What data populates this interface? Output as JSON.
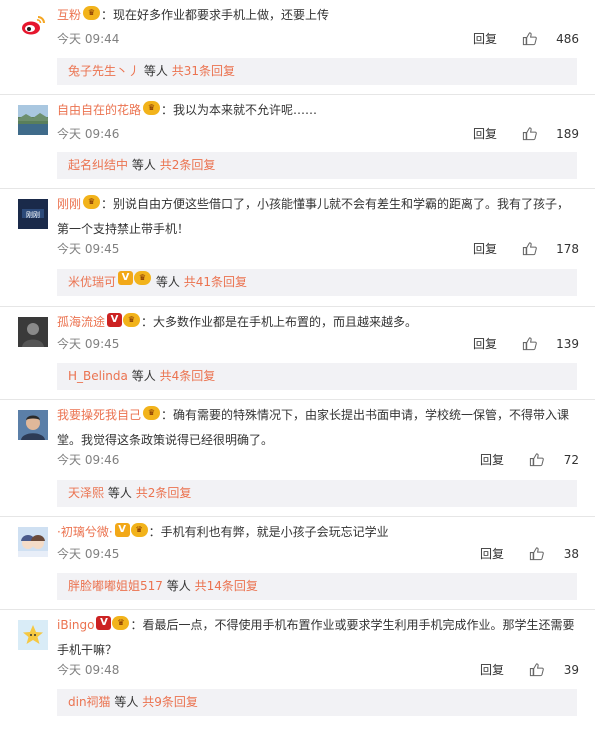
{
  "comments": [
    {
      "username": "互粉",
      "badges": [
        "vip"
      ],
      "text": "现在好多作业都要求手机上做，还要上传",
      "text2": "",
      "time": "今天 09:44",
      "reply_label": "回复",
      "likes": "486",
      "replies_user": "兔子先生丶丿",
      "replies_mid": "等人",
      "replies_total": "共31条回复",
      "avatar": "weibo-logo"
    },
    {
      "username": "自由自在的花路",
      "badges": [
        "vip"
      ],
      "text": "我以为本来就不允许呢……",
      "text2": "",
      "time": "今天 09:46",
      "reply_label": "回复",
      "likes": "189",
      "replies_user": "起名纠结中",
      "replies_mid": "等人",
      "replies_total": "共2条回复",
      "avatar": "landscape"
    },
    {
      "username": "刚刚",
      "badges": [
        "vip"
      ],
      "text": "别说自由方便这些借口了，小孩能懂事儿就不会有差生和学霸的距离了。我有了孩子，",
      "text2": "第一个支持禁止带手机！",
      "time": "今天 09:45",
      "reply_label": "回复",
      "likes": "178",
      "replies_user": "米优瑞可",
      "replies_mid": "等人",
      "replies_total": "共41条回复",
      "avatar": "gangang-logo"
    },
    {
      "username": "孤海流途",
      "badges": [
        "v",
        "vip"
      ],
      "text": "大多数作业都是在手机上布置的，而且越来越多。",
      "text2": "",
      "time": "今天 09:45",
      "reply_label": "回复",
      "likes": "139",
      "replies_user": "H_Belinda",
      "replies_mid": "等人",
      "replies_total": "共4条回复",
      "avatar": "portrait-dark"
    },
    {
      "username": "我要操死我自己",
      "badges": [
        "vip"
      ],
      "text": "确有需要的特殊情况下，由家长提出书面申请，学校统一保管，不得带入课",
      "text2": "堂。我觉得这条政策说得已经很明确了。",
      "time": "今天 09:46",
      "reply_label": "回复",
      "likes": "72",
      "replies_user": "天泽熙",
      "replies_mid": "等人",
      "replies_total": "共2条回复",
      "avatar": "portrait-man"
    },
    {
      "username": "·初璃兮微·",
      "badges": [
        "v",
        "vip"
      ],
      "text": "手机有利也有弊，就是小孩子会玩忘记学业",
      "text2": "",
      "time": "今天 09:45",
      "reply_label": "回复",
      "likes": "38",
      "replies_user": "胖脸嘟嘟姐姐517",
      "replies_mid": "等人",
      "replies_total": "共14条回复",
      "avatar": "anime"
    },
    {
      "username": "iBingo",
      "badges": [
        "v",
        "vip"
      ],
      "text": "看最后一点，不得使用手机布置作业或要求学生利用手机完成作业。那学生还需要",
      "text2": "手机干嘛？",
      "time": "今天 09:48",
      "reply_label": "回复",
      "likes": "39",
      "replies_user": "din祠猫",
      "replies_mid": "等人",
      "replies_total": "共9条回复",
      "avatar": "star"
    }
  ],
  "colors": {
    "accent": "#eb7350",
    "reply_bg": "#f2f2f5"
  }
}
